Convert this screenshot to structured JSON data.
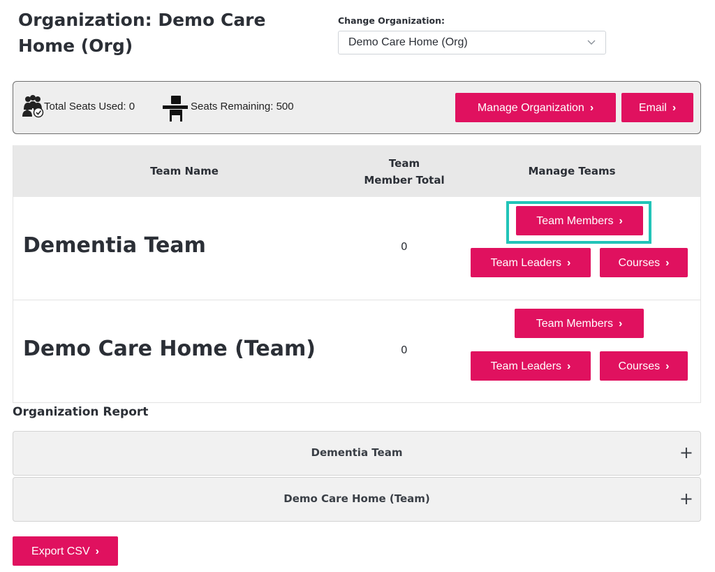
{
  "header": {
    "org_title": "Organization: Demo Care Home (Org)",
    "change_org_label": "Change Organization:",
    "selected_org": "Demo Care Home (Org)"
  },
  "seats": {
    "used_text": "Total Seats Used: 0",
    "remaining_text": "Seats Remaining: 500",
    "manage_org_label": "Manage Organization",
    "email_label": "Email"
  },
  "table": {
    "headers": [
      "Team Name",
      "Team Member Total",
      "Manage Teams"
    ],
    "header_member_line1": "Team",
    "header_member_line2": "Member Total",
    "rows": [
      {
        "name": "Dementia Team",
        "members": "0",
        "members_btn": "Team Members",
        "leaders_btn": "Team Leaders",
        "courses_btn": "Courses"
      },
      {
        "name": "Demo Care Home (Team)",
        "members": "0",
        "members_btn": "Team Members",
        "leaders_btn": "Team Leaders",
        "courses_btn": "Courses"
      }
    ]
  },
  "report": {
    "title": "Organization Report",
    "items": [
      "Dementia Team",
      "Demo Care Home (Team)"
    ],
    "export_label": "Export CSV"
  },
  "colors": {
    "accent": "#e0115f",
    "highlight": "#22c4b8"
  },
  "icons": {
    "arrow": "›",
    "expand": "+",
    "dropdown": "chevron-down-icon"
  }
}
